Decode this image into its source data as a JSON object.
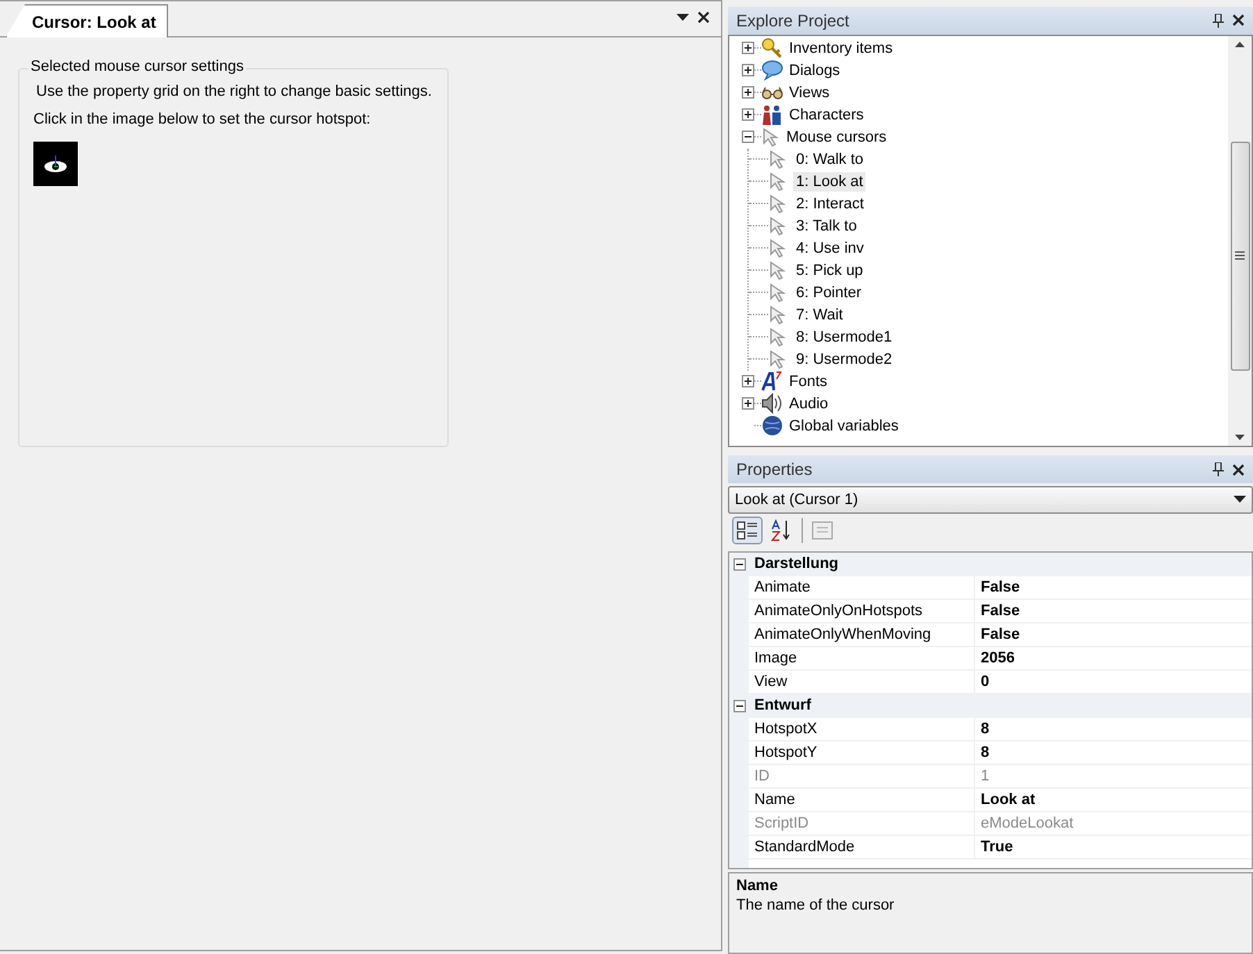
{
  "document_tab": {
    "title": "Cursor: Look at",
    "selected": true
  },
  "cursor_settings": {
    "group_title": "Selected mouse cursor settings",
    "hint": "Use the property grid on the right to change basic settings.",
    "instruction": "Click in the image below to set the cursor hotspot:"
  },
  "explore_project": {
    "title": "Explore Project",
    "items": [
      {
        "label": "Inventory items",
        "kind": "keys",
        "expanded": false,
        "selected": false
      },
      {
        "label": "Dialogs",
        "kind": "bubble",
        "expanded": false,
        "selected": false
      },
      {
        "label": "Views",
        "kind": "glasses",
        "expanded": false,
        "selected": false
      },
      {
        "label": "Characters",
        "kind": "people",
        "expanded": false,
        "selected": false
      },
      {
        "label": "Mouse cursors",
        "kind": "cursor",
        "expanded": true,
        "selected": false,
        "children": [
          {
            "label": "0: Walk to",
            "selected": false
          },
          {
            "label": "1: Look at",
            "selected": true
          },
          {
            "label": "2: Interact",
            "selected": false
          },
          {
            "label": "3: Talk to",
            "selected": false
          },
          {
            "label": "4: Use inv",
            "selected": false
          },
          {
            "label": "5: Pick up",
            "selected": false
          },
          {
            "label": "6: Pointer",
            "selected": false
          },
          {
            "label": "7: Wait",
            "selected": false
          },
          {
            "label": "8: Usermode1",
            "selected": false
          },
          {
            "label": "9: Usermode2",
            "selected": false
          }
        ]
      },
      {
        "label": "Fonts",
        "kind": "font",
        "expanded": false,
        "selected": false
      },
      {
        "label": "Audio",
        "kind": "speaker",
        "expanded": false,
        "selected": false
      },
      {
        "label": "Global variables",
        "kind": "globe",
        "selected": false
      }
    ]
  },
  "properties": {
    "title": "Properties",
    "object": "Look at (Cursor 1)",
    "categorized": true,
    "categories": [
      {
        "name": "Darstellung",
        "expanded": true,
        "rows": [
          {
            "name": "Animate",
            "value": "False",
            "modified": true,
            "readonly": false
          },
          {
            "name": "AnimateOnlyOnHotspots",
            "value": "False",
            "modified": true,
            "readonly": false
          },
          {
            "name": "AnimateOnlyWhenMoving",
            "value": "False",
            "modified": true,
            "readonly": false
          },
          {
            "name": "Image",
            "value": "2056",
            "modified": true,
            "readonly": false
          },
          {
            "name": "View",
            "value": "0",
            "modified": true,
            "readonly": false
          }
        ]
      },
      {
        "name": "Entwurf",
        "expanded": true,
        "rows": [
          {
            "name": "HotspotX",
            "value": "8",
            "modified": true,
            "readonly": false
          },
          {
            "name": "HotspotY",
            "value": "8",
            "modified": true,
            "readonly": false
          },
          {
            "name": "ID",
            "value": "1",
            "modified": false,
            "readonly": true
          },
          {
            "name": "Name",
            "value": "Look at",
            "modified": true,
            "readonly": false
          },
          {
            "name": "ScriptID",
            "value": "eModeLookat",
            "modified": false,
            "readonly": true
          },
          {
            "name": "StandardMode",
            "value": "True",
            "modified": true,
            "readonly": false
          }
        ]
      }
    ],
    "description": {
      "title": "Name",
      "text": "The name of the cursor"
    }
  }
}
